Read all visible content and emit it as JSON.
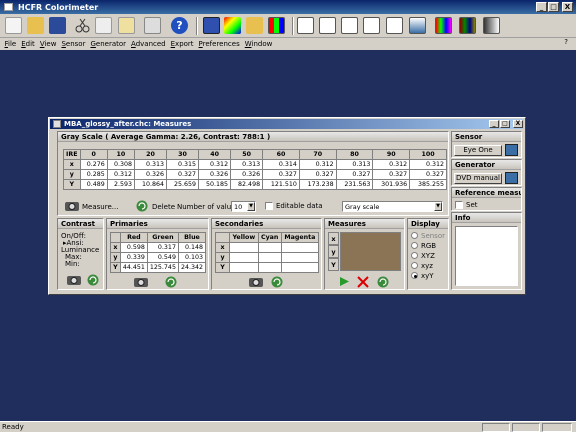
{
  "app": {
    "title": "HCFR Colorimeter",
    "minimize_glyph": "_",
    "maximize_glyph": "□",
    "close_glyph": "X"
  },
  "menu": {
    "items": [
      "File",
      "Edit",
      "View",
      "Sensor",
      "Generator",
      "Advanced",
      "Export",
      "Preferences",
      "Window"
    ],
    "help": "?"
  },
  "status": {
    "text": "Ready"
  },
  "doc": {
    "title": "MBA_glossy_after.chc: Measures",
    "grayscale": {
      "header": "Gray Scale ( Average Gamma: 2.26, Contrast: 788:1 )",
      "columns": [
        "IRE",
        "0",
        "10",
        "20",
        "30",
        "40",
        "50",
        "60",
        "70",
        "80",
        "90",
        "100"
      ],
      "rows": [
        {
          "label": "x",
          "values": [
            "0.276",
            "0.308",
            "0.313",
            "0.315",
            "0.312",
            "0.313",
            "0.314",
            "0.312",
            "0.313",
            "0.312",
            "0.312"
          ]
        },
        {
          "label": "y",
          "values": [
            "0.285",
            "0.312",
            "0.326",
            "0.327",
            "0.326",
            "0.326",
            "0.327",
            "0.327",
            "0.327",
            "0.327",
            "0.327"
          ]
        },
        {
          "label": "Y",
          "values": [
            "0.489",
            "2.593",
            "10.864",
            "25.659",
            "50.185",
            "82.498",
            "121.510",
            "173.238",
            "231.563",
            "301.936",
            "385.255"
          ]
        }
      ],
      "measure_label": "Measure...",
      "delete_label": "Delete",
      "num_values_label": "Number of values",
      "num_values": "10",
      "editable_label": "Editable data",
      "mode": "Gray scale"
    },
    "contrast": {
      "title": "Contrast",
      "onoff": "On/Off:",
      "ansi": "Ansi:",
      "luminance": "Luminance",
      "max": "Max:",
      "min": "Min:"
    },
    "primaries": {
      "title": "Primaries",
      "columns": [
        "Red",
        "Green",
        "Blue"
      ],
      "rows": [
        {
          "label": "x",
          "values": [
            "0.598",
            "0.317",
            "0.148"
          ]
        },
        {
          "label": "y",
          "values": [
            "0.339",
            "0.549",
            "0.103"
          ]
        },
        {
          "label": "Y",
          "values": [
            "44.451",
            "125.745",
            "24.342"
          ]
        }
      ]
    },
    "secondaries": {
      "title": "Secondaries",
      "columns": [
        "Yellow",
        "Cyan",
        "Magenta"
      ],
      "row_labels": [
        "x",
        "y",
        "Y"
      ]
    },
    "measures": {
      "title": "Measures",
      "row_labels": [
        "x",
        "y",
        "Y"
      ],
      "swatch_color": "#8b7355"
    },
    "display": {
      "title": "Display",
      "options": [
        "Sensor",
        "RGB",
        "XYZ",
        "xyz",
        "xyY"
      ],
      "selected": "xyY"
    },
    "sensor": {
      "title": "Sensor",
      "value": "Eye One"
    },
    "generator": {
      "title": "Generator",
      "value": "DVD manual"
    },
    "reference": {
      "title": "Reference measure",
      "set_label": "Set"
    },
    "info": {
      "title": "Info"
    }
  }
}
